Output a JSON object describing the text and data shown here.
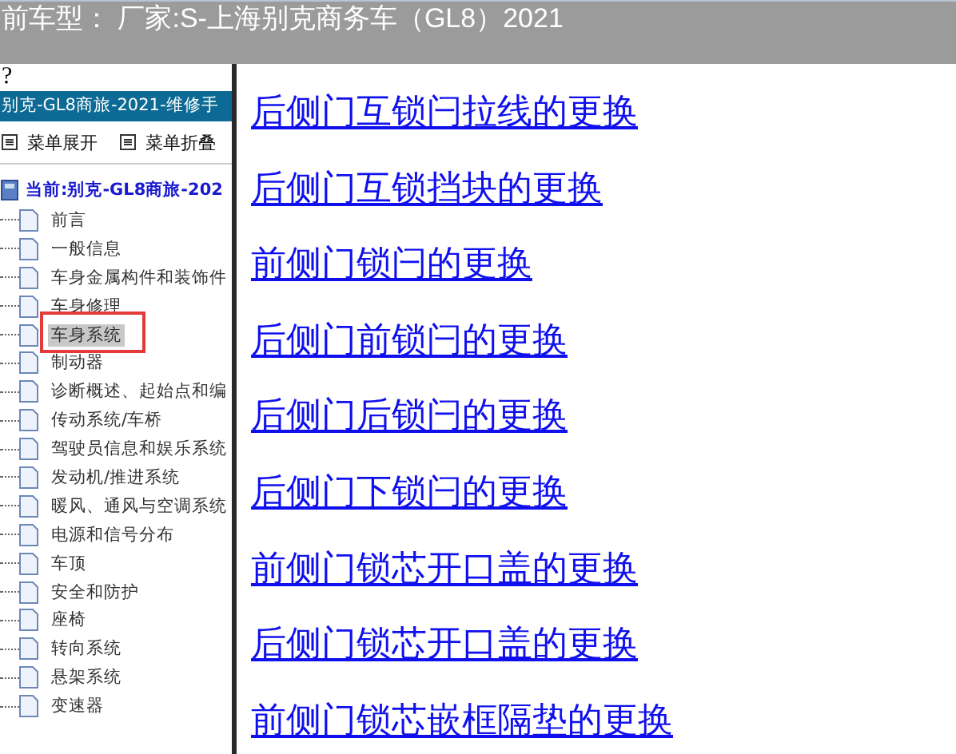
{
  "header": {
    "title": "前车型： 厂家:S-上海别克商务车（GL8）2021"
  },
  "sidebar": {
    "help": "?",
    "manual_title": "别克-GL8商旅-2021-维修手",
    "menu_buttons": [
      {
        "label": "菜单展开"
      },
      {
        "label": "菜单折叠"
      }
    ],
    "tree": {
      "label": "当前:别克-GL8商旅-202",
      "children": [
        {
          "label": "前言",
          "selected": false
        },
        {
          "label": "一般信息",
          "selected": false
        },
        {
          "label": "车身金属构件和装饰件",
          "selected": false
        },
        {
          "label": "车身修理",
          "selected": false
        },
        {
          "label": "车身系统",
          "selected": true
        },
        {
          "label": "制动器",
          "selected": false
        },
        {
          "label": "诊断概述、起始点和编",
          "selected": false
        },
        {
          "label": "传动系统/车桥",
          "selected": false
        },
        {
          "label": "驾驶员信息和娱乐系统",
          "selected": false
        },
        {
          "label": "发动机/推进系统",
          "selected": false
        },
        {
          "label": "暖风、通风与空调系统",
          "selected": false
        },
        {
          "label": "电源和信号分布",
          "selected": false
        },
        {
          "label": "车顶",
          "selected": false
        },
        {
          "label": "安全和防护",
          "selected": false
        },
        {
          "label": "座椅",
          "selected": false
        },
        {
          "label": "转向系统",
          "selected": false
        },
        {
          "label": "悬架系统",
          "selected": false
        },
        {
          "label": "变速器",
          "selected": false
        }
      ]
    }
  },
  "links": [
    "后侧门互锁闩拉线的更换",
    "后侧门互锁挡块的更换",
    "前侧门锁闩的更换",
    "后侧门前锁闩的更换",
    "后侧门后锁闩的更换",
    "后侧门下锁闩的更换",
    "前侧门锁芯开口盖的更换",
    "后侧门锁芯开口盖的更换",
    "前侧门锁芯嵌框隔垫的更换"
  ]
}
